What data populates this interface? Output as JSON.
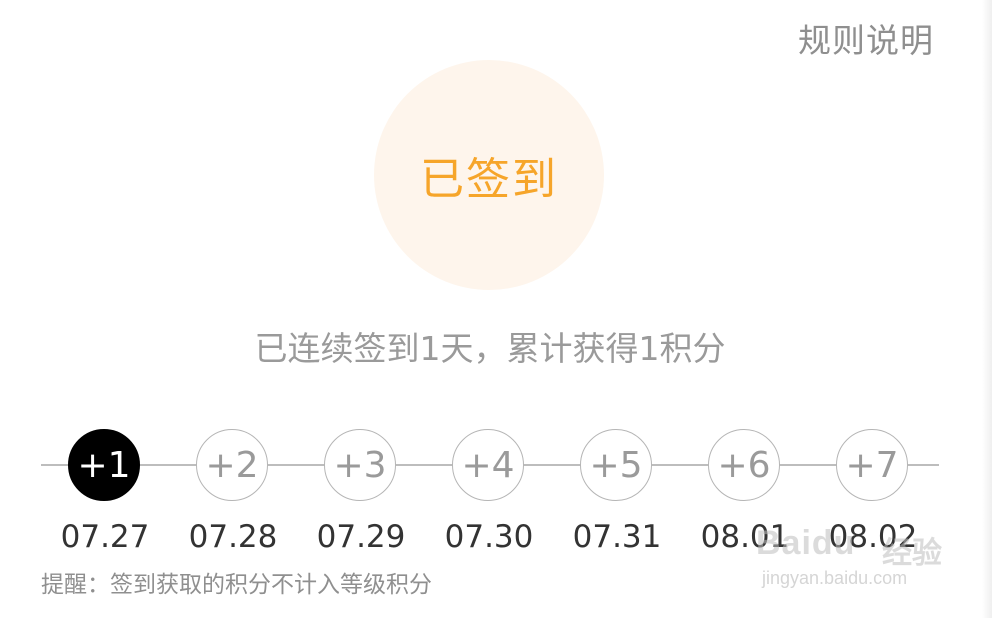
{
  "header": {
    "rules_label": "规则说明"
  },
  "sign_button": {
    "label": "已签到",
    "accent_color": "#f6a52a",
    "bg_color": "#fef5ec"
  },
  "summary": {
    "text": "已连续签到1天，累计获得1积分"
  },
  "days": [
    {
      "points": "+1",
      "date": "07.27",
      "signed": true
    },
    {
      "points": "+2",
      "date": "07.28",
      "signed": false
    },
    {
      "points": "+3",
      "date": "07.29",
      "signed": false
    },
    {
      "points": "+4",
      "date": "07.30",
      "signed": false
    },
    {
      "points": "+5",
      "date": "07.31",
      "signed": false
    },
    {
      "points": "+6",
      "date": "08.01",
      "signed": false
    },
    {
      "points": "+7",
      "date": "08.02",
      "signed": false
    }
  ],
  "notice": {
    "text": "提醒：签到获取的积分不计入等级积分"
  },
  "watermark": {
    "brand": "Baidu",
    "cn": "经验",
    "url": "jingyan.baidu.com"
  }
}
